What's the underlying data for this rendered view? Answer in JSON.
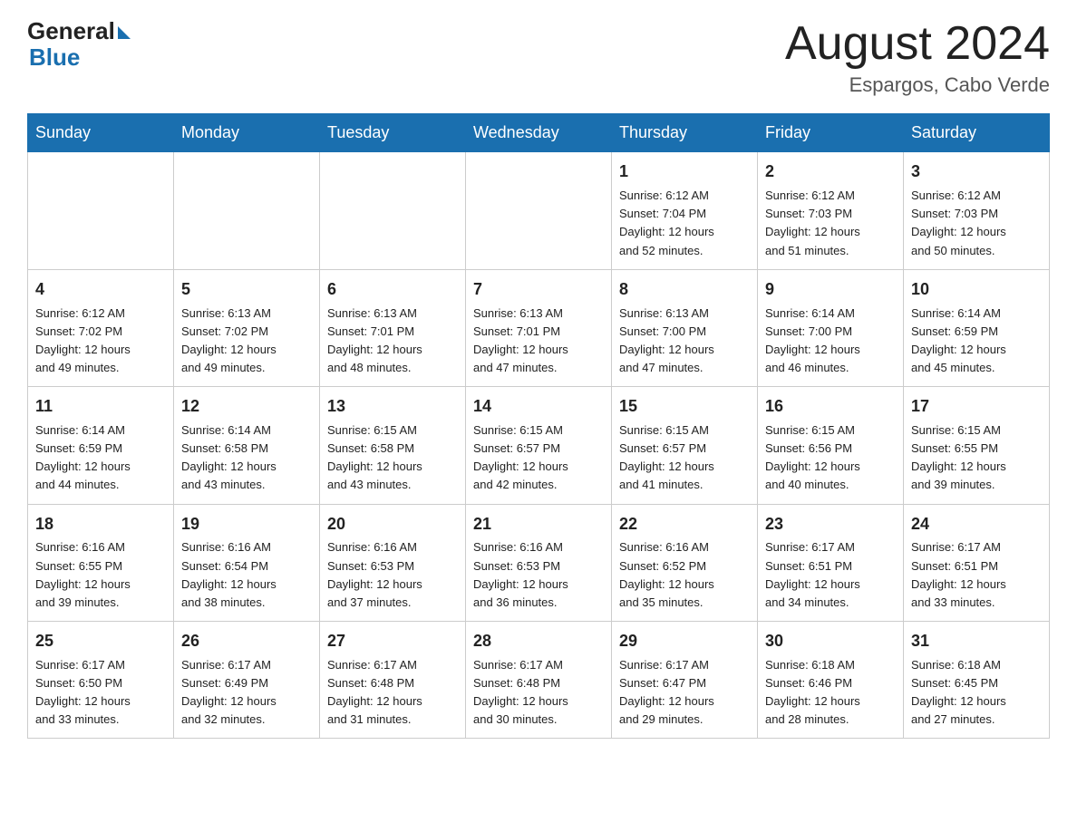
{
  "header": {
    "logo_general": "General",
    "logo_blue": "Blue",
    "month_title": "August 2024",
    "location": "Espargos, Cabo Verde"
  },
  "days_of_week": [
    "Sunday",
    "Monday",
    "Tuesday",
    "Wednesday",
    "Thursday",
    "Friday",
    "Saturday"
  ],
  "weeks": [
    [
      {
        "day": "",
        "info": ""
      },
      {
        "day": "",
        "info": ""
      },
      {
        "day": "",
        "info": ""
      },
      {
        "day": "",
        "info": ""
      },
      {
        "day": "1",
        "info": "Sunrise: 6:12 AM\nSunset: 7:04 PM\nDaylight: 12 hours\nand 52 minutes."
      },
      {
        "day": "2",
        "info": "Sunrise: 6:12 AM\nSunset: 7:03 PM\nDaylight: 12 hours\nand 51 minutes."
      },
      {
        "day": "3",
        "info": "Sunrise: 6:12 AM\nSunset: 7:03 PM\nDaylight: 12 hours\nand 50 minutes."
      }
    ],
    [
      {
        "day": "4",
        "info": "Sunrise: 6:12 AM\nSunset: 7:02 PM\nDaylight: 12 hours\nand 49 minutes."
      },
      {
        "day": "5",
        "info": "Sunrise: 6:13 AM\nSunset: 7:02 PM\nDaylight: 12 hours\nand 49 minutes."
      },
      {
        "day": "6",
        "info": "Sunrise: 6:13 AM\nSunset: 7:01 PM\nDaylight: 12 hours\nand 48 minutes."
      },
      {
        "day": "7",
        "info": "Sunrise: 6:13 AM\nSunset: 7:01 PM\nDaylight: 12 hours\nand 47 minutes."
      },
      {
        "day": "8",
        "info": "Sunrise: 6:13 AM\nSunset: 7:00 PM\nDaylight: 12 hours\nand 47 minutes."
      },
      {
        "day": "9",
        "info": "Sunrise: 6:14 AM\nSunset: 7:00 PM\nDaylight: 12 hours\nand 46 minutes."
      },
      {
        "day": "10",
        "info": "Sunrise: 6:14 AM\nSunset: 6:59 PM\nDaylight: 12 hours\nand 45 minutes."
      }
    ],
    [
      {
        "day": "11",
        "info": "Sunrise: 6:14 AM\nSunset: 6:59 PM\nDaylight: 12 hours\nand 44 minutes."
      },
      {
        "day": "12",
        "info": "Sunrise: 6:14 AM\nSunset: 6:58 PM\nDaylight: 12 hours\nand 43 minutes."
      },
      {
        "day": "13",
        "info": "Sunrise: 6:15 AM\nSunset: 6:58 PM\nDaylight: 12 hours\nand 43 minutes."
      },
      {
        "day": "14",
        "info": "Sunrise: 6:15 AM\nSunset: 6:57 PM\nDaylight: 12 hours\nand 42 minutes."
      },
      {
        "day": "15",
        "info": "Sunrise: 6:15 AM\nSunset: 6:57 PM\nDaylight: 12 hours\nand 41 minutes."
      },
      {
        "day": "16",
        "info": "Sunrise: 6:15 AM\nSunset: 6:56 PM\nDaylight: 12 hours\nand 40 minutes."
      },
      {
        "day": "17",
        "info": "Sunrise: 6:15 AM\nSunset: 6:55 PM\nDaylight: 12 hours\nand 39 minutes."
      }
    ],
    [
      {
        "day": "18",
        "info": "Sunrise: 6:16 AM\nSunset: 6:55 PM\nDaylight: 12 hours\nand 39 minutes."
      },
      {
        "day": "19",
        "info": "Sunrise: 6:16 AM\nSunset: 6:54 PM\nDaylight: 12 hours\nand 38 minutes."
      },
      {
        "day": "20",
        "info": "Sunrise: 6:16 AM\nSunset: 6:53 PM\nDaylight: 12 hours\nand 37 minutes."
      },
      {
        "day": "21",
        "info": "Sunrise: 6:16 AM\nSunset: 6:53 PM\nDaylight: 12 hours\nand 36 minutes."
      },
      {
        "day": "22",
        "info": "Sunrise: 6:16 AM\nSunset: 6:52 PM\nDaylight: 12 hours\nand 35 minutes."
      },
      {
        "day": "23",
        "info": "Sunrise: 6:17 AM\nSunset: 6:51 PM\nDaylight: 12 hours\nand 34 minutes."
      },
      {
        "day": "24",
        "info": "Sunrise: 6:17 AM\nSunset: 6:51 PM\nDaylight: 12 hours\nand 33 minutes."
      }
    ],
    [
      {
        "day": "25",
        "info": "Sunrise: 6:17 AM\nSunset: 6:50 PM\nDaylight: 12 hours\nand 33 minutes."
      },
      {
        "day": "26",
        "info": "Sunrise: 6:17 AM\nSunset: 6:49 PM\nDaylight: 12 hours\nand 32 minutes."
      },
      {
        "day": "27",
        "info": "Sunrise: 6:17 AM\nSunset: 6:48 PM\nDaylight: 12 hours\nand 31 minutes."
      },
      {
        "day": "28",
        "info": "Sunrise: 6:17 AM\nSunset: 6:48 PM\nDaylight: 12 hours\nand 30 minutes."
      },
      {
        "day": "29",
        "info": "Sunrise: 6:17 AM\nSunset: 6:47 PM\nDaylight: 12 hours\nand 29 minutes."
      },
      {
        "day": "30",
        "info": "Sunrise: 6:18 AM\nSunset: 6:46 PM\nDaylight: 12 hours\nand 28 minutes."
      },
      {
        "day": "31",
        "info": "Sunrise: 6:18 AM\nSunset: 6:45 PM\nDaylight: 12 hours\nand 27 minutes."
      }
    ]
  ]
}
